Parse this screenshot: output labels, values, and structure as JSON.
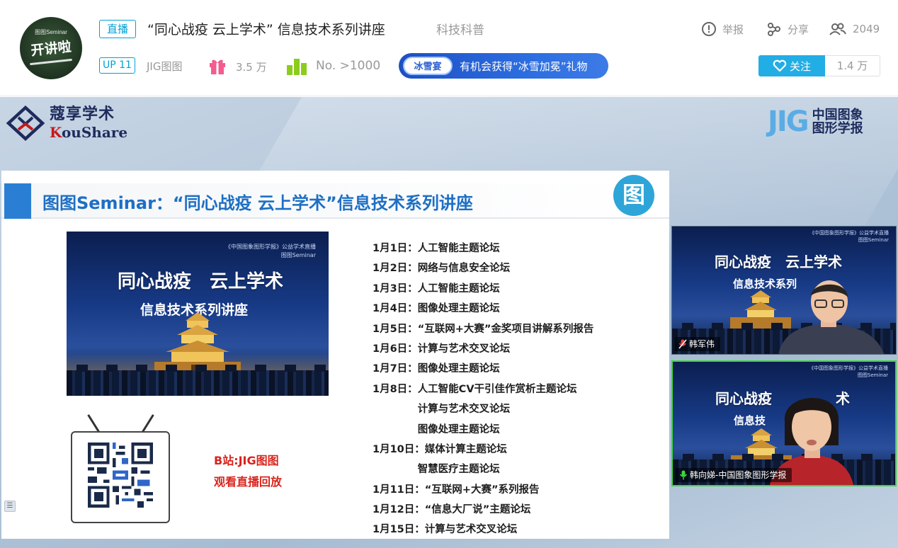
{
  "header": {
    "avatar_top": "图图Seminar",
    "avatar_main": "开讲啦",
    "live_tag": "直播",
    "title": "“同心战疫 云上学术” 信息技术系列讲座",
    "category": "科技科普",
    "report_label": "举报",
    "share_label": "分享",
    "viewers": "2049",
    "up_level": "UP 11",
    "up_name": "JIG图图",
    "gift_count": "3.5 万",
    "rank": "No. >1000",
    "promo_badge": "冰雪宴",
    "promo_text": "有机会获得“冰雪加冕”礼物",
    "follow_label": "关注",
    "follow_count": "1.4 万"
  },
  "stage": {
    "koushare_cn": "蔻享学术",
    "koushare_en_k": "K",
    "koushare_en_rest": "ouShare",
    "jig_mark": "JIG",
    "jig_cn_line1": "中国图象",
    "jig_cn_line2": "图形学报"
  },
  "slide": {
    "title": "图图Seminar：“同心战疫 云上学术”信息技术系列讲座",
    "logo_glyph": "图",
    "poster_small1": "《中国图象图形学报》公益学术直播",
    "poster_small2": "图图Seminar",
    "poster_title": "同心战疫　云上学术",
    "poster_sub": "信息技术系列讲座",
    "bstation": "B站:JIG图图",
    "replay": "观看直播回放",
    "schedule": [
      {
        "date": "1月1日：",
        "topic": "人工智能主题论坛"
      },
      {
        "date": "1月2日：",
        "topic": "网络与信息安全论坛"
      },
      {
        "date": "1月3日：",
        "topic": "人工智能主题论坛"
      },
      {
        "date": "1月4日：",
        "topic": "图像处理主题论坛"
      },
      {
        "date": "1月5日：",
        "topic": "“互联网+大赛”金奖项目讲解系列报告"
      },
      {
        "date": "1月6日：",
        "topic": "计算与艺术交叉论坛"
      },
      {
        "date": "1月7日：",
        "topic": "图像处理主题论坛"
      },
      {
        "date": "1月8日：",
        "topic": "人工智能CV干引佳作赏析主题论坛"
      },
      {
        "date": "",
        "topic": "计算与艺术交叉论坛"
      },
      {
        "date": "",
        "topic": "图像处理主题论坛"
      },
      {
        "date": "1月10日：",
        "topic": "媒体计算主题论坛"
      },
      {
        "date": "",
        "topic": "智慧医疗主题论坛"
      },
      {
        "date": "1月11日：",
        "topic": "“互联网+大赛”系列报告"
      },
      {
        "date": "1月12日：",
        "topic": "“信息大厂说”主题论坛"
      },
      {
        "date": "1月15日：",
        "topic": "计算与艺术交叉论坛"
      }
    ]
  },
  "cams": {
    "cam1_title": "同心战疫　云上学术",
    "cam1_sub": "信息技术系列",
    "cam1_label": "韩军伟",
    "cam2_title": "同心战疫",
    "cam2_title_r": "术",
    "cam2_sub": "信息技",
    "cam2_label": "韩向娣-中国图象图形学报",
    "cam_small": "《中国图象图形学报》公益学术直播",
    "cam_small2": "图图Seminar"
  },
  "side_toggle": "☰",
  "colors": {
    "accent": "#00a1d6",
    "follow": "#23ade5",
    "slide_title": "#1e6fc4",
    "red_text": "#d9241c"
  }
}
